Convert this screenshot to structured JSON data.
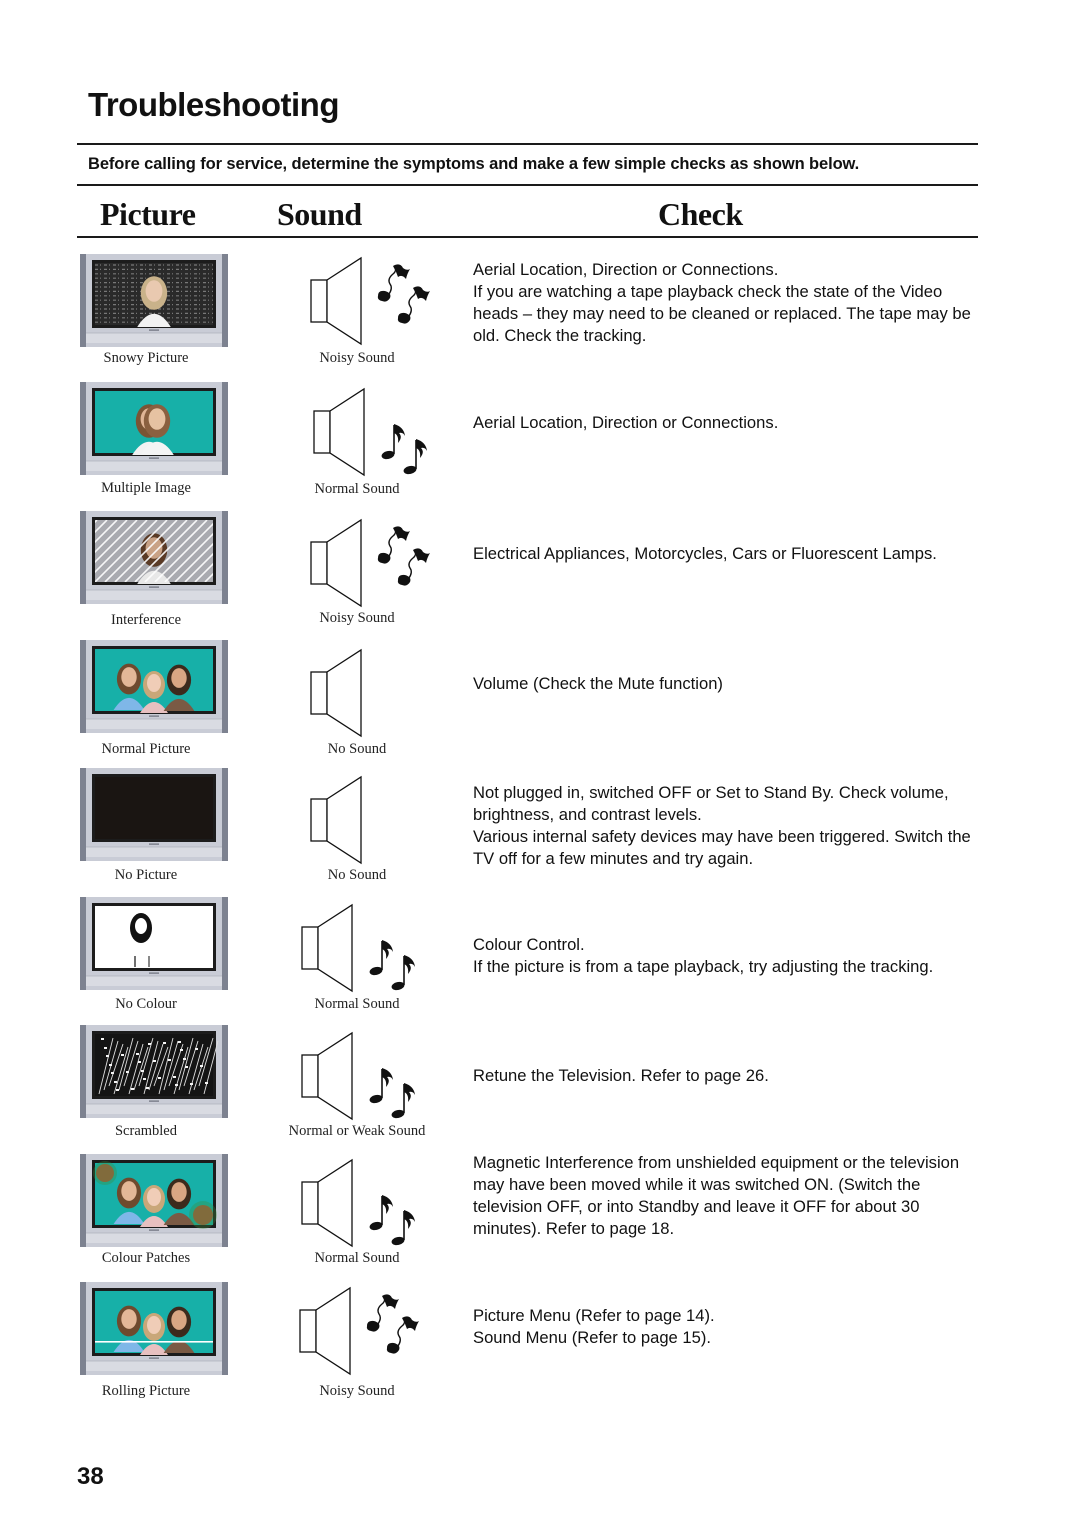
{
  "page": {
    "title": "Troubleshooting",
    "intro": "Before calling for service, determine the symptoms and make a few simple checks as shown below.",
    "page_number": "38"
  },
  "columns": {
    "picture": "Picture",
    "sound": "Sound",
    "check": "Check"
  },
  "rows": [
    {
      "picture": "Snowy Picture",
      "picture_icon": "tv-snowy-picture-icon",
      "sound": "Noisy Sound",
      "sound_icon": "speaker-noisy-notes-icon",
      "check": [
        "Aerial Location, Direction or Connections.",
        "If you are watching a tape playback check the state of the Video heads – they may need to be cleaned or replaced. The tape may be old. Check the tracking."
      ]
    },
    {
      "picture": "Multiple Image",
      "picture_icon": "tv-multiple-image-icon",
      "sound": "Normal Sound",
      "sound_icon": "speaker-normal-notes-icon",
      "check": [
        "Aerial Location, Direction or Connections."
      ]
    },
    {
      "picture": "Interference",
      "picture_icon": "tv-interference-icon",
      "sound": "Noisy Sound",
      "sound_icon": "speaker-noisy-notes-icon",
      "check": [
        "Electrical Appliances, Motorcycles, Cars or Fluorescent Lamps."
      ]
    },
    {
      "picture": "Normal Picture",
      "picture_icon": "tv-normal-picture-icon",
      "sound": "No Sound",
      "sound_icon": "speaker-silent-icon",
      "check": [
        "Volume (Check the Mute function)"
      ]
    },
    {
      "picture": "No Picture",
      "picture_icon": "tv-no-picture-icon",
      "sound": "No Sound",
      "sound_icon": "speaker-silent-icon",
      "check": [
        "Not plugged in, switched OFF or Set to Stand By. Check volume, brightness, and contrast levels.",
        "Various internal safety devices may have been triggered. Switch the TV off for a few minutes and try again."
      ]
    },
    {
      "picture": "No Colour",
      "picture_icon": "tv-no-colour-icon",
      "sound": "Normal Sound",
      "sound_icon": "speaker-normal-notes-icon",
      "check": [
        "Colour Control.",
        "If the picture is from a tape playback, try adjusting the tracking."
      ]
    },
    {
      "picture": "Scrambled",
      "picture_icon": "tv-scrambled-icon",
      "sound": "Normal or Weak Sound",
      "sound_icon": "speaker-normal-notes-icon",
      "check": [
        "Retune the Television. Refer to page 26."
      ]
    },
    {
      "picture": "Colour Patches",
      "picture_icon": "tv-colour-patches-icon",
      "sound": "Normal Sound",
      "sound_icon": "speaker-normal-notes-icon",
      "check": [
        "Magnetic Interference from unshielded equipment or the television may have been moved while it was switched ON. (Switch the television OFF, or into Standby and leave it OFF for about 30 minutes). Refer to page 18."
      ]
    },
    {
      "picture": "Rolling Picture",
      "picture_icon": "tv-rolling-picture-icon",
      "sound": "Noisy Sound",
      "sound_icon": "speaker-noisy-notes-icon",
      "check": [
        "Picture Menu (Refer to page 14).",
        "Sound Menu (Refer to page 15)."
      ]
    }
  ],
  "colors": {
    "screen_teal": "#17b0a8",
    "tv_frame": "#c9ccd6",
    "tv_side": "#7d8290",
    "screen_black": "#1a1512"
  }
}
